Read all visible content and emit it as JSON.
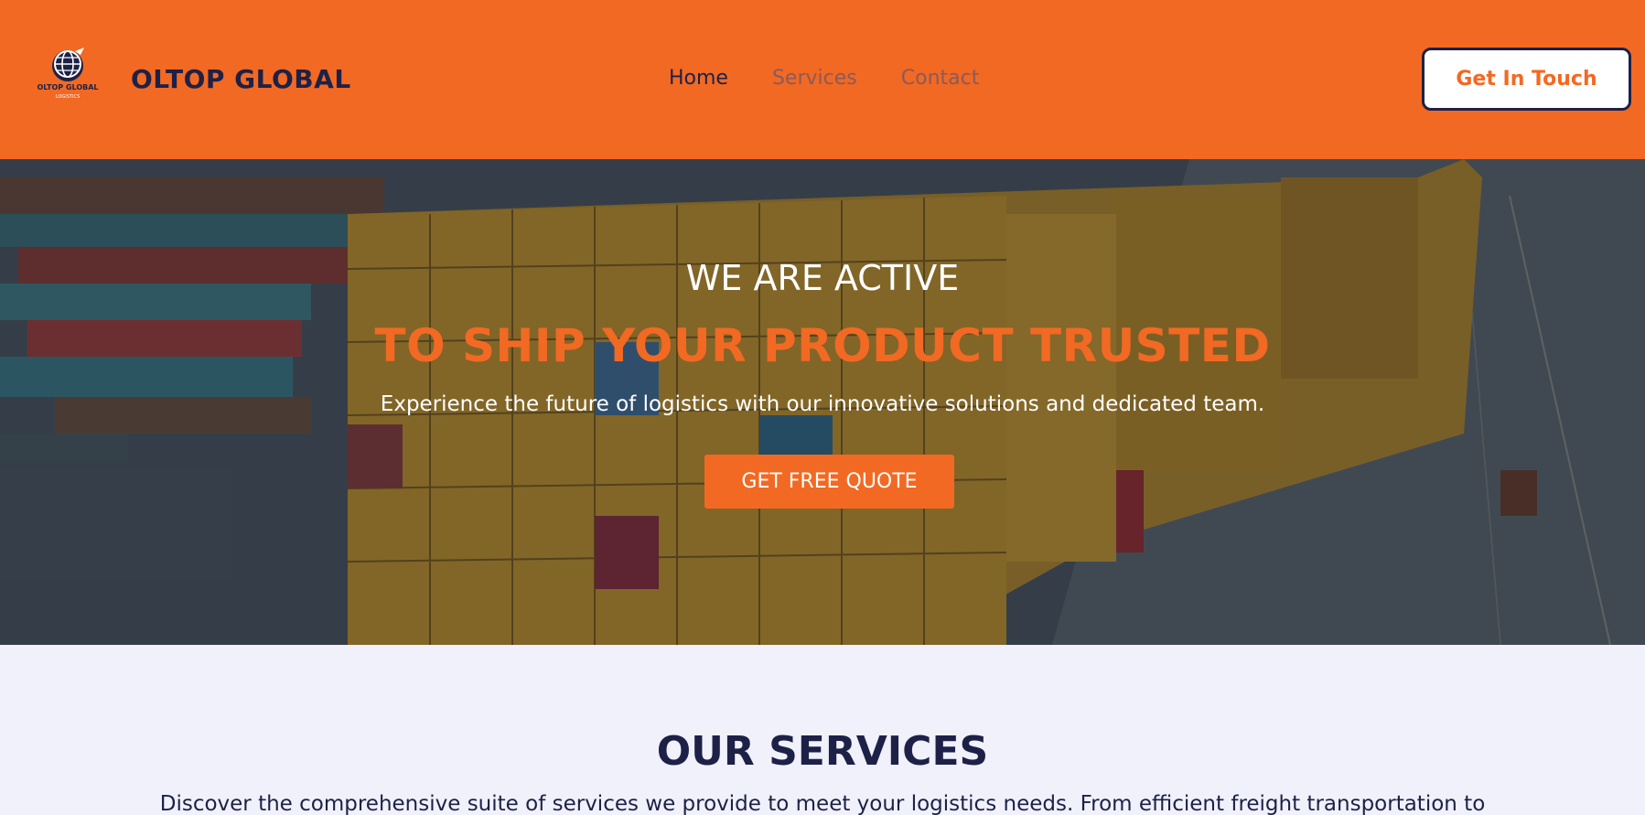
{
  "header": {
    "logo_text": "OLTOP GLOBAL",
    "logo_subtext": "LOGISTICS",
    "brand": "OLTOP GLOBAL",
    "nav": [
      {
        "label": "Home"
      },
      {
        "label": "Services"
      },
      {
        "label": "Contact"
      }
    ],
    "cta_label": "Get In Touch"
  },
  "hero": {
    "kicker": "WE ARE ACTIVE",
    "title": "TO SHIP YOUR PRODUCT TRUSTED",
    "subtitle": "Experience the future of logistics with our innovative solutions and dedicated team.",
    "button_label": "GET FREE QUOTE",
    "image": "shipping-containers-port-photo"
  },
  "services": {
    "title": "OUR SERVICES",
    "description": "Discover the comprehensive suite of services we provide to meet your logistics needs. From efficient freight transportation to"
  },
  "colors": {
    "brand_orange": "#f26923",
    "navy": "#1d2147",
    "section_bg": "#f0f1fa"
  }
}
